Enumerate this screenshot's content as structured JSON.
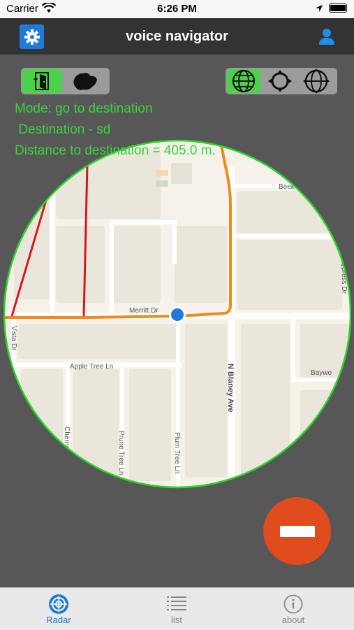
{
  "status": {
    "carrier": "Carrier",
    "time": "6:26 PM"
  },
  "nav": {
    "title": "voice navigator"
  },
  "info": {
    "mode": "Mode: go to destination",
    "destination": " Destination - sd",
    "distance": "Distance to destination = 405.0 m."
  },
  "map": {
    "streets": {
      "merritt": "Merritt Dr",
      "apple": "Apple Tree Ln",
      "blaney": "N Blaney Ave",
      "vista": "Vista Dr",
      "cherry": "Cherry",
      "prune": "Prune Tree Ln",
      "plum": "Plum Tree Ln",
      "beek": "Beek",
      "cypress": "Cypress Dr",
      "baywo": "Baywo"
    },
    "colors": {
      "route": "#f08a1c",
      "red_line": "#d8161e",
      "ring": "#27d827",
      "location": "#1e7bd8"
    }
  },
  "tabs": [
    {
      "label": "Radar",
      "icon": "radar-icon"
    },
    {
      "label": "list",
      "icon": "list-icon"
    },
    {
      "label": "about",
      "icon": "info-icon"
    }
  ]
}
